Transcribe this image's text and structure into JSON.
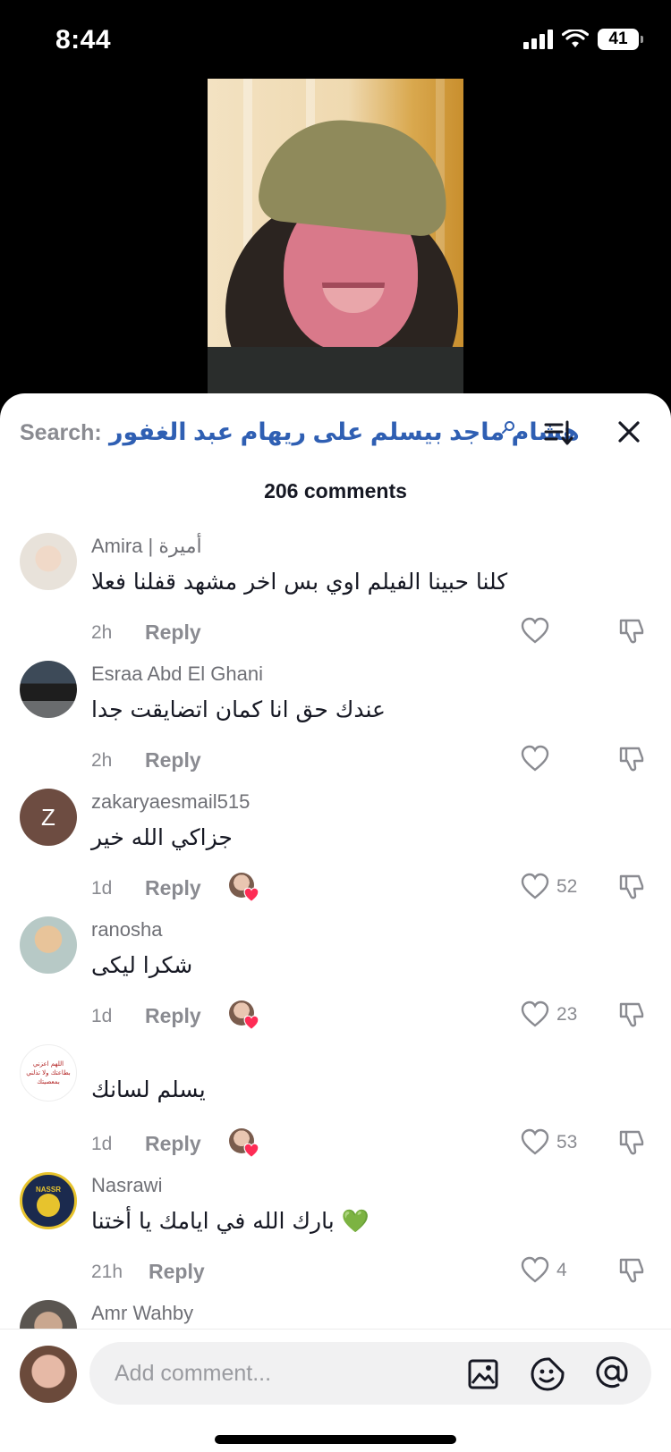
{
  "status_bar": {
    "time": "8:44",
    "battery": "41"
  },
  "search": {
    "label": "Search:",
    "query": "هشام ماجد بيسلم على ريهام عبد الغفور"
  },
  "comments_count": "206 comments",
  "reply_label": "Reply",
  "comments": [
    {
      "user": "Amira | أميرة",
      "text": "كلنا حبينا الفيلم اوي بس اخر مشهد قفلنا فعلا",
      "time": "2h",
      "likes": "",
      "creator_liked": false,
      "avatar_color": "#d9c8b9"
    },
    {
      "user": "Esraa Abd El Ghani",
      "text": "عندك حق انا كمان اتضايقت جدا",
      "time": "2h",
      "likes": "",
      "creator_liked": false,
      "avatar_color": "#6a6c6e"
    },
    {
      "user": "zakaryaesmail515",
      "text": "جزاكي الله خير",
      "time": "1d",
      "likes": "52",
      "creator_liked": true,
      "avatar_letter": "Z",
      "avatar_color": "#6d4c41"
    },
    {
      "user": "ranosha",
      "text": "شكرا ليكى",
      "time": "1d",
      "likes": "23",
      "creator_liked": true,
      "avatar_color": "#b7c9c6"
    },
    {
      "user": "",
      "text": "يسلم لسانك",
      "time": "1d",
      "likes": "53",
      "creator_liked": true,
      "avatar_color": "#ffffff",
      "avatar_caption": "اللهم اعزني بطاعتك ولا تذلني بمعصيتك"
    },
    {
      "user": "Nasrawi",
      "text": "بارك الله في ايامك يا أختنا 💚",
      "time": "21h",
      "likes": "4",
      "creator_liked": false,
      "avatar_color": "#1b2a4e",
      "avatar_caption": "NASSR"
    },
    {
      "user": "Amr Wahby",
      "text": "",
      "time": "",
      "likes": "",
      "creator_liked": false,
      "avatar_color": "#8a8078"
    }
  ],
  "composer": {
    "placeholder": "Add comment..."
  },
  "colors": {
    "accent_blue": "#2f5fb3",
    "heart_red": "#fe2c55",
    "muted": "#8a8b91"
  }
}
